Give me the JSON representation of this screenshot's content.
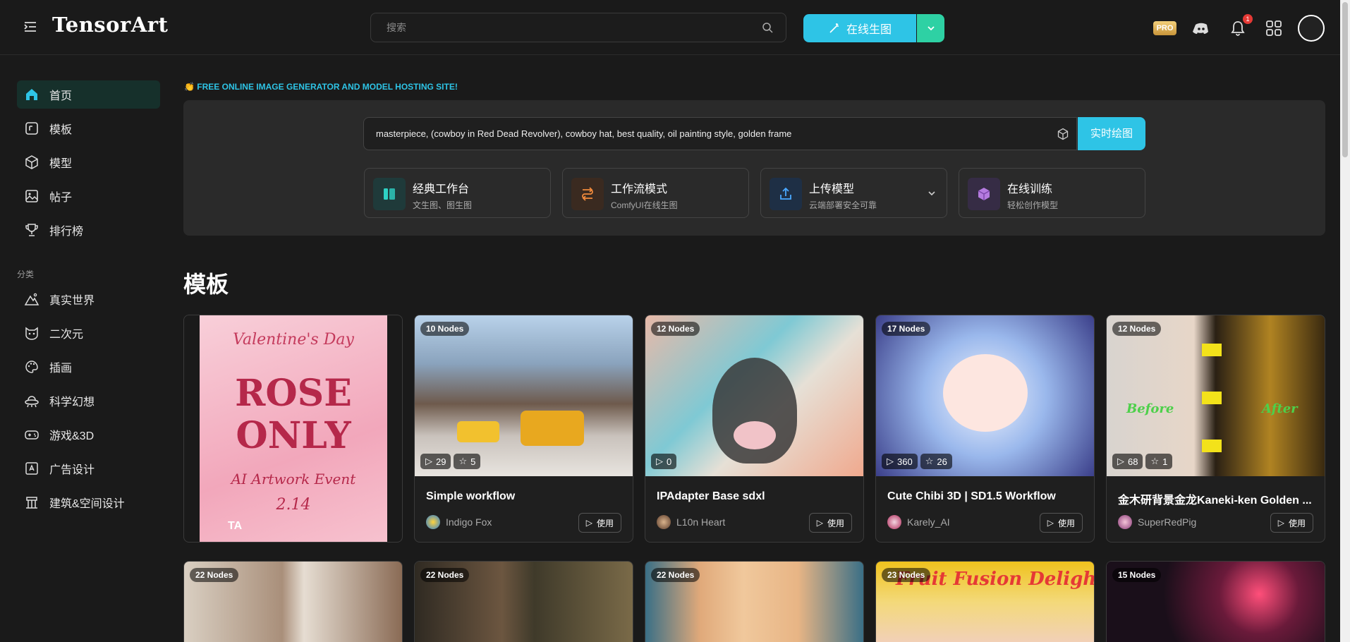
{
  "header": {
    "logo": "TensorArt",
    "search_placeholder": "搜索",
    "generate_label": "在线生图",
    "pro_label": "PRO",
    "notification_count": "1"
  },
  "sidebar": {
    "items": [
      {
        "label": "首页",
        "icon": "home-icon",
        "active": true
      },
      {
        "label": "模板",
        "icon": "template-icon"
      },
      {
        "label": "模型",
        "icon": "cube-icon"
      },
      {
        "label": "帖子",
        "icon": "image-icon"
      },
      {
        "label": "排行榜",
        "icon": "trophy-icon"
      }
    ],
    "category_label": "分类",
    "categories": [
      {
        "label": "真实世界",
        "icon": "mountain-icon"
      },
      {
        "label": "二次元",
        "icon": "cat-face-icon"
      },
      {
        "label": "插画",
        "icon": "palette-icon"
      },
      {
        "label": "科学幻想",
        "icon": "ufo-icon"
      },
      {
        "label": "游戏&3D",
        "icon": "gamepad-icon"
      },
      {
        "label": "广告设计",
        "icon": "ad-icon"
      },
      {
        "label": "建筑&空间设计",
        "icon": "building-icon"
      }
    ]
  },
  "hero": {
    "banner": "👏 FREE ONLINE IMAGE GENERATOR AND MODEL HOSTING SITE!",
    "prompt": "masterpiece, (cowboy in Red Dead Revolver), cowboy hat, best quality, oil painting style, golden frame",
    "realtime_label": "实时绘图",
    "cards": [
      {
        "title": "经典工作台",
        "subtitle": "文生图、图生图"
      },
      {
        "title": "工作流模式",
        "subtitle": "ComfyUI在线生图"
      },
      {
        "title": "上传模型",
        "subtitle": "云端部署安全可靠"
      },
      {
        "title": "在线训练",
        "subtitle": "轻松创作模型"
      }
    ]
  },
  "section_title": "模板",
  "templates": [
    {
      "nodes": "",
      "title": "",
      "author": "",
      "promo_line1": "Valentine's Day",
      "promo_line2": "ROSE",
      "promo_line3": "ONLY",
      "promo_line4": "AI Artwork Event",
      "promo_line5": "2.14"
    },
    {
      "nodes": "10 Nodes",
      "runs": "29",
      "stars": "5",
      "title": "Simple workflow",
      "author": "Indigo Fox",
      "use": "使用"
    },
    {
      "nodes": "12 Nodes",
      "runs": "0",
      "title": "IPAdapter Base sdxl",
      "author": "L10n Heart",
      "use": "使用"
    },
    {
      "nodes": "17 Nodes",
      "runs": "360",
      "stars": "26",
      "title": "Cute Chibi 3D | SD1.5 Workflow",
      "author": "Karely_AI",
      "use": "使用"
    },
    {
      "nodes": "12 Nodes",
      "runs": "68",
      "stars": "1",
      "title": "金木研背景金龙Kaneki-ken Golden ...",
      "author": "SuperRedPig",
      "use": "使用",
      "before": "Before",
      "after": "After"
    }
  ],
  "templates_row2": [
    {
      "nodes": "22 Nodes"
    },
    {
      "nodes": "22 Nodes"
    },
    {
      "nodes": "22 Nodes"
    },
    {
      "nodes": "23 Nodes",
      "overlay": "Fruit Fusion Delight"
    },
    {
      "nodes": "15 Nodes"
    }
  ]
}
